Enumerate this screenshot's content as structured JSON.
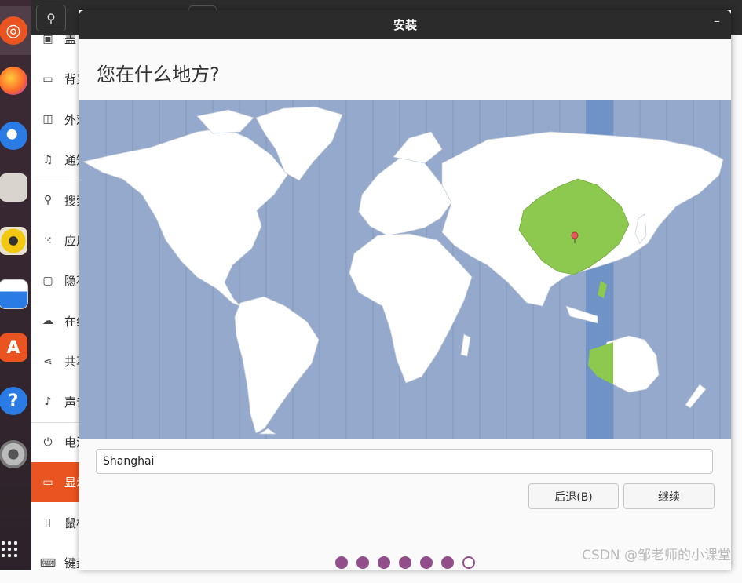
{
  "window": {
    "title": "安装",
    "minimize_glyph": "–"
  },
  "page": {
    "heading": "您在什么地方?"
  },
  "location": {
    "value": "Shanghai"
  },
  "buttons": {
    "back": "后退(B)",
    "continue": "继续"
  },
  "settings_sidebar": {
    "items": [
      {
        "label": "盖",
        "icon": "screen-lock-icon"
      },
      {
        "label": "背景",
        "icon": "background-icon"
      },
      {
        "label": "外观",
        "icon": "appearance-icon"
      },
      {
        "label": "通知",
        "icon": "notifications-icon"
      },
      {
        "label": "搜索",
        "icon": "search-icon"
      },
      {
        "label": "应用",
        "icon": "applications-icon"
      },
      {
        "label": "隐私",
        "icon": "privacy-lock-icon"
      },
      {
        "label": "在线",
        "icon": "cloud-icon"
      },
      {
        "label": "共享",
        "icon": "share-icon"
      },
      {
        "label": "声音",
        "icon": "music-note-icon"
      },
      {
        "label": "电源",
        "icon": "power-icon"
      },
      {
        "label": "显示",
        "icon": "display-icon"
      },
      {
        "label": "鼠标",
        "icon": "mouse-icon"
      },
      {
        "label": "键盘",
        "icon": "keyboard-icon"
      }
    ],
    "active_index": 11
  },
  "dock": {
    "apps": [
      "ubuntu-icon",
      "firefox-icon",
      "thunderbird-icon",
      "files-icon",
      "rhythmbox-icon",
      "libreoffice-writer-icon",
      "software-center-icon",
      "help-icon",
      "settings-gear-icon"
    ]
  },
  "progress": {
    "total_steps": 7,
    "completed_steps": 6
  },
  "colors": {
    "accent": "#e95420",
    "progress_dot": "#924d8b",
    "ocean": "#94a9cb",
    "selected_zone": "#6f93c6",
    "selected_country": "#8cc94e"
  },
  "watermark": "CSDN @邹老师的小课堂"
}
